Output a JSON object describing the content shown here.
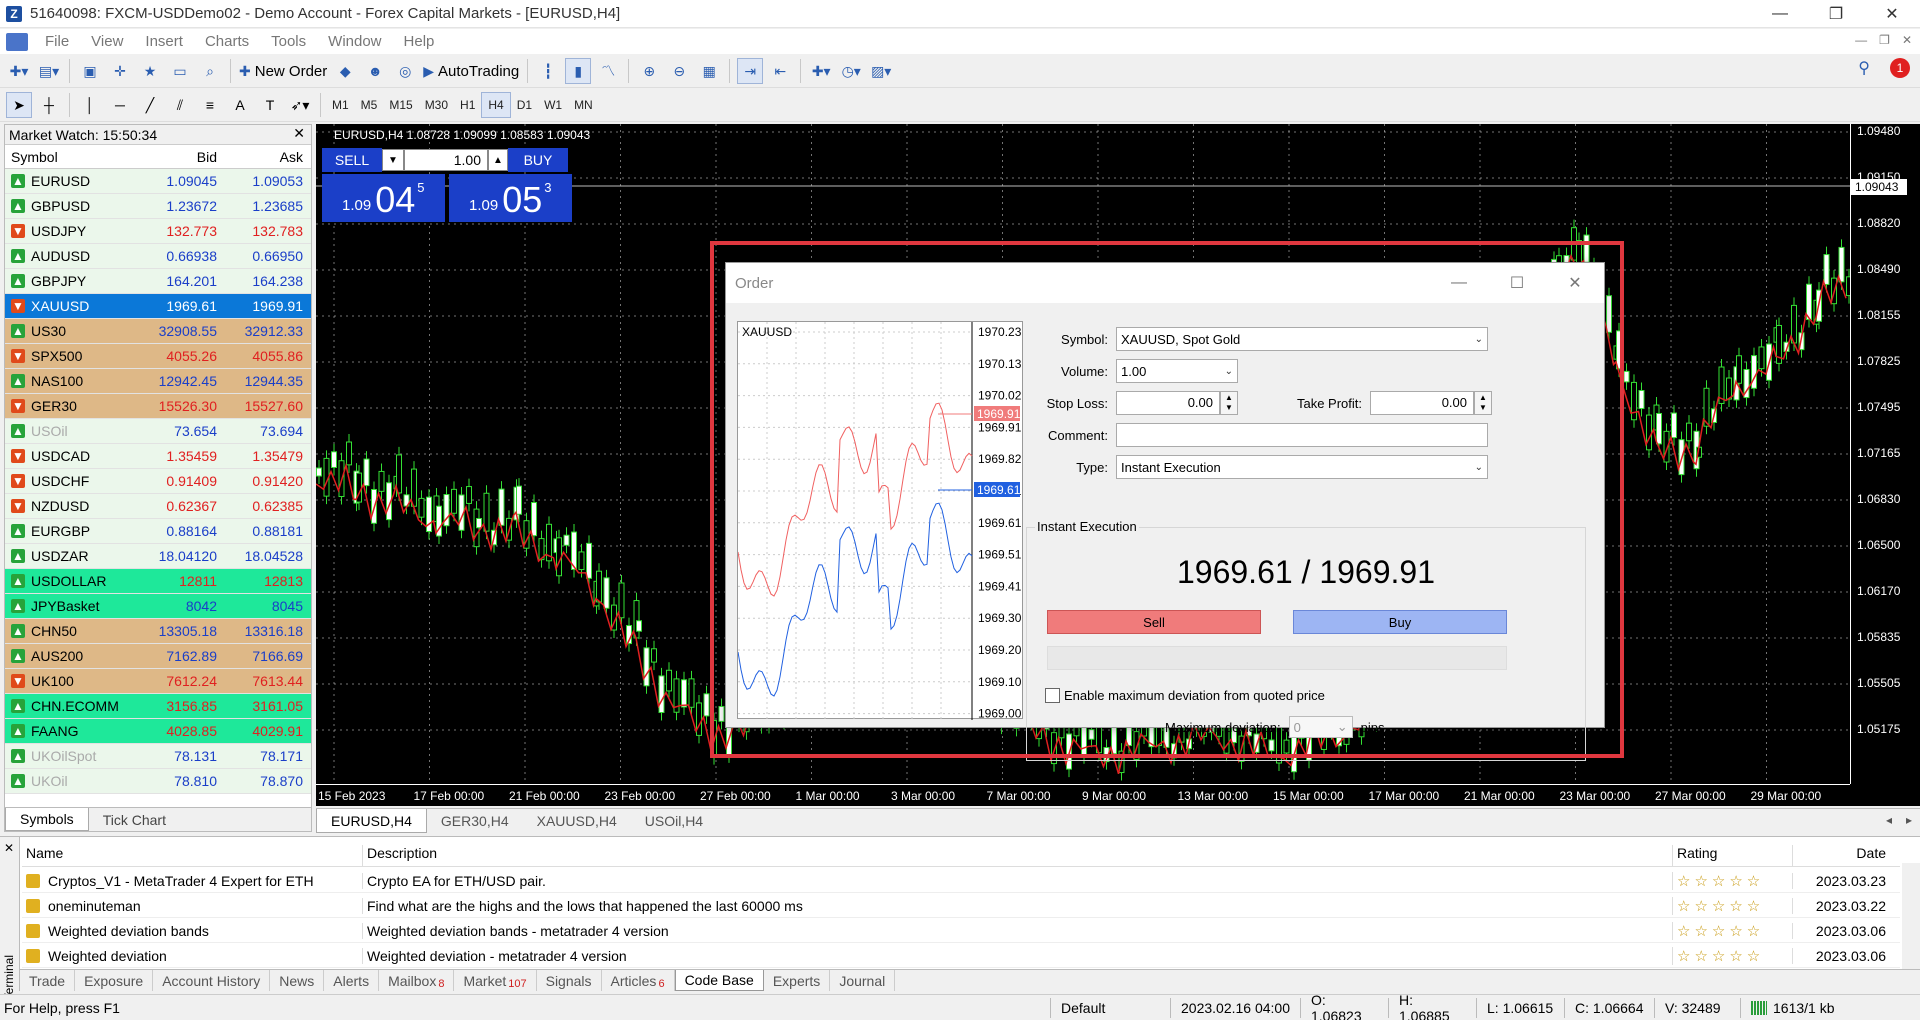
{
  "window": {
    "title": "51640098: FXCM-USDDemo02 - Demo Account - Forex Capital Markets - [EURUSD,H4]",
    "icon": "z-logo-icon"
  },
  "menu": [
    "File",
    "View",
    "Insert",
    "Charts",
    "Tools",
    "Window",
    "Help"
  ],
  "toolbar": {
    "new_order": "New Order",
    "autotrading": "AutoTrading",
    "notifications": "1"
  },
  "timeframes": [
    "M1",
    "M5",
    "M15",
    "M30",
    "H1",
    "H4",
    "D1",
    "W1",
    "MN"
  ],
  "market_watch": {
    "title": "Market Watch: 15:50:34",
    "cols": {
      "symbol": "Symbol",
      "bid": "Bid",
      "ask": "Ask"
    },
    "rows": [
      {
        "symbol": "EURUSD",
        "bid": "1.09045",
        "ask": "1.09053",
        "dir": "up",
        "bg": "#ebf7eb",
        "color": "#1a3ec8"
      },
      {
        "symbol": "GBPUSD",
        "bid": "1.23672",
        "ask": "1.23685",
        "dir": "up",
        "bg": "#ebf7eb",
        "color": "#1a3ec8"
      },
      {
        "symbol": "USDJPY",
        "bid": "132.773",
        "ask": "132.783",
        "dir": "dn",
        "bg": "#ebf7eb",
        "color": "#e02020"
      },
      {
        "symbol": "AUDUSD",
        "bid": "0.66938",
        "ask": "0.66950",
        "dir": "up",
        "bg": "#ebf7eb",
        "color": "#1a3ec8"
      },
      {
        "symbol": "GBPJPY",
        "bid": "164.201",
        "ask": "164.238",
        "dir": "up",
        "bg": "#ebf7eb",
        "color": "#1a3ec8"
      },
      {
        "symbol": "XAUUSD",
        "bid": "1969.61",
        "ask": "1969.91",
        "dir": "dn",
        "bg": "#0b78d8",
        "color": "#ffffff",
        "selected": true
      },
      {
        "symbol": "US30",
        "bid": "32908.55",
        "ask": "32912.33",
        "dir": "up",
        "bg": "#deb887",
        "color": "#1a3ec8"
      },
      {
        "symbol": "SPX500",
        "bid": "4055.26",
        "ask": "4055.86",
        "dir": "dn",
        "bg": "#deb887",
        "color": "#e02020"
      },
      {
        "symbol": "NAS100",
        "bid": "12942.45",
        "ask": "12944.35",
        "dir": "up",
        "bg": "#deb887",
        "color": "#1a3ec8"
      },
      {
        "symbol": "GER30",
        "bid": "15526.30",
        "ask": "15527.60",
        "dir": "dn",
        "bg": "#deb887",
        "color": "#e02020"
      },
      {
        "symbol": "USOil",
        "bid": "73.654",
        "ask": "73.694",
        "dir": "up",
        "bg": "#ebf7eb",
        "color": "#1a3ec8",
        "dim": true
      },
      {
        "symbol": "USDCAD",
        "bid": "1.35459",
        "ask": "1.35479",
        "dir": "dn",
        "bg": "#ebf7eb",
        "color": "#e02020"
      },
      {
        "symbol": "USDCHF",
        "bid": "0.91409",
        "ask": "0.91420",
        "dir": "dn",
        "bg": "#ebf7eb",
        "color": "#e02020"
      },
      {
        "symbol": "NZDUSD",
        "bid": "0.62367",
        "ask": "0.62385",
        "dir": "dn",
        "bg": "#ebf7eb",
        "color": "#e02020"
      },
      {
        "symbol": "EURGBP",
        "bid": "0.88164",
        "ask": "0.88181",
        "dir": "up",
        "bg": "#ebf7eb",
        "color": "#1a3ec8"
      },
      {
        "symbol": "USDZAR",
        "bid": "18.04120",
        "ask": "18.04528",
        "dir": "up",
        "bg": "#ebf7eb",
        "color": "#1a3ec8"
      },
      {
        "symbol": "USDOLLAR",
        "bid": "12811",
        "ask": "12813",
        "dir": "up",
        "bg": "#1ee89a",
        "color": "#e02020"
      },
      {
        "symbol": "JPYBasket",
        "bid": "8042",
        "ask": "8045",
        "dir": "up",
        "bg": "#1ee89a",
        "color": "#1a3ec8"
      },
      {
        "symbol": "CHN50",
        "bid": "13305.18",
        "ask": "13316.18",
        "dir": "up",
        "bg": "#deb887",
        "color": "#1a3ec8"
      },
      {
        "symbol": "AUS200",
        "bid": "7162.89",
        "ask": "7166.69",
        "dir": "up",
        "bg": "#deb887",
        "color": "#1a3ec8"
      },
      {
        "symbol": "UK100",
        "bid": "7612.24",
        "ask": "7613.44",
        "dir": "dn",
        "bg": "#deb887",
        "color": "#e02020"
      },
      {
        "symbol": "CHN.ECOMM",
        "bid": "3156.85",
        "ask": "3161.05",
        "dir": "up",
        "bg": "#1ee89a",
        "color": "#e02020"
      },
      {
        "symbol": "FAANG",
        "bid": "4028.85",
        "ask": "4029.91",
        "dir": "up",
        "bg": "#1ee89a",
        "color": "#e02020"
      },
      {
        "symbol": "UKOilSpot",
        "bid": "78.131",
        "ask": "78.171",
        "dir": "up",
        "bg": "#ebf7eb",
        "color": "#1a3ec8",
        "dim": true
      },
      {
        "symbol": "UKOil",
        "bid": "78.810",
        "ask": "78.870",
        "dir": "up",
        "bg": "#ebf7eb",
        "color": "#1a3ec8",
        "dim": true
      }
    ],
    "tabs": [
      "Symbols",
      "Tick Chart"
    ]
  },
  "chart": {
    "title": "EURUSD,H4  1.08728 1.09099 1.08583 1.09043",
    "one_click": {
      "sell": "SELL",
      "buy": "BUY",
      "volume": "1.00",
      "sell_small": "1.09",
      "sell_big": "04",
      "sell_sup": "5",
      "buy_small": "1.09",
      "buy_big": "05",
      "buy_sup": "3"
    },
    "price_labels": [
      "1.09480",
      "1.09150",
      "1.08820",
      "1.08490",
      "1.08155",
      "1.07825",
      "1.07495",
      "1.07165",
      "1.06830",
      "1.06500",
      "1.06170",
      "1.05835",
      "1.05505",
      "1.05175"
    ],
    "current_price": "1.09043",
    "time_labels": [
      "15 Feb 2023",
      "17 Feb 00:00",
      "21 Feb 00:00",
      "23 Feb 00:00",
      "27 Feb 00:00",
      "1 Mar 00:00",
      "3 Mar 00:00",
      "7 Mar 00:00",
      "9 Mar 00:00",
      "13 Mar 00:00",
      "15 Mar 00:00",
      "17 Mar 00:00",
      "21 Mar 00:00",
      "23 Mar 00:00",
      "27 Mar 00:00",
      "29 Mar 00:00"
    ],
    "tabs": [
      "EURUSD,H4",
      "GER30,H4",
      "XAUUSD,H4",
      "USOil,H4"
    ]
  },
  "order": {
    "title": "Order",
    "mini_chart": {
      "symbol": "XAUUSD",
      "labels": [
        "1970.23",
        "1970.13",
        "1970.02",
        "1969.91",
        "1969.82",
        "1969.71",
        "1969.61",
        "1969.51",
        "1969.41",
        "1969.30",
        "1969.20",
        "1969.10",
        "1969.00"
      ],
      "ask_tag": "1969.91",
      "bid_tag": "1969.61"
    },
    "symbol_label": "Symbol:",
    "symbol_value": "XAUUSD, Spot Gold",
    "volume_label": "Volume:",
    "volume_value": "1.00",
    "sl_label": "Stop Loss:",
    "sl_value": "0.00",
    "tp_label": "Take Profit:",
    "tp_value": "0.00",
    "comment_label": "Comment:",
    "comment_value": "",
    "type_label": "Type:",
    "type_value": "Instant Execution",
    "group_title": "Instant Execution",
    "price": "1969.61 / 1969.91",
    "sell": "Sell",
    "buy": "Buy",
    "deviation_check": "Enable maximum deviation from quoted price",
    "deviation_label": "Maximum deviation:",
    "deviation_value": "0",
    "deviation_unit": "pips"
  },
  "terminal": {
    "label": "Terminal",
    "cols": {
      "name": "Name",
      "desc": "Description",
      "rating": "Rating",
      "date": "Date"
    },
    "rows": [
      {
        "name": "Cryptos_V1 - MetaTrader 4 Expert for ETH",
        "desc": "Crypto EA for ETH/USD pair.",
        "date": "2023.03.23"
      },
      {
        "name": "oneminuteman",
        "desc": "Find what are the highs and the lows that happened the last 60000 ms",
        "date": "2023.03.22"
      },
      {
        "name": "Weighted deviation bands",
        "desc": "Weighted deviation bands - metatrader 4 version",
        "date": "2023.03.06"
      },
      {
        "name": "Weighted deviation",
        "desc": "Weighted deviation - metatrader 4 version",
        "date": "2023.03.06"
      }
    ],
    "stars": "☆☆☆☆☆",
    "tabs": [
      {
        "label": "Trade",
        "badge": ""
      },
      {
        "label": "Exposure",
        "badge": ""
      },
      {
        "label": "Account History",
        "badge": ""
      },
      {
        "label": "News",
        "badge": ""
      },
      {
        "label": "Alerts",
        "badge": ""
      },
      {
        "label": "Mailbox",
        "badge": "8"
      },
      {
        "label": "Market",
        "badge": "107"
      },
      {
        "label": "Signals",
        "badge": ""
      },
      {
        "label": "Articles",
        "badge": "6"
      },
      {
        "label": "Code Base",
        "badge": "",
        "active": true
      },
      {
        "label": "Experts",
        "badge": ""
      },
      {
        "label": "Journal",
        "badge": ""
      }
    ]
  },
  "status": {
    "help": "For Help, press F1",
    "profile": "Default",
    "datetime": "2023.02.16 04:00",
    "open": "O: 1.06823",
    "high": "H: 1.06885",
    "low": "L: 1.06615",
    "close": "C: 1.06664",
    "volume": "V: 32489",
    "traffic": "1613/1 kb"
  }
}
